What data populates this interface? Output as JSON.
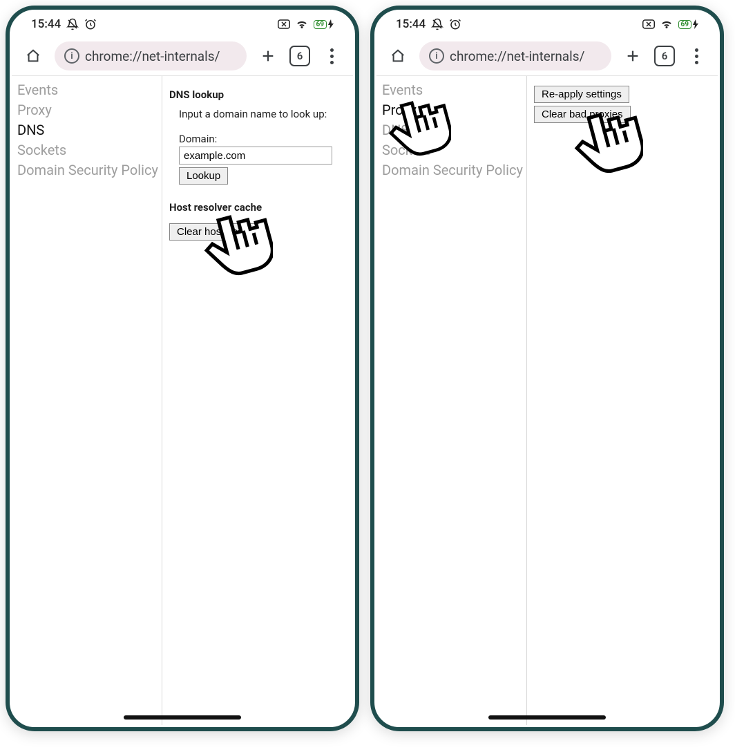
{
  "statusbar": {
    "time": "15:44",
    "battery": "69"
  },
  "chrome": {
    "url": "chrome://net-internals/",
    "tab_count": "6"
  },
  "sidebar": {
    "items": [
      {
        "label": "Events"
      },
      {
        "label": "Proxy"
      },
      {
        "label": "DNS"
      },
      {
        "label": "Sockets"
      },
      {
        "label": "Domain Security Policy"
      }
    ]
  },
  "left_panel": {
    "active_index": 2,
    "dns_heading": "DNS lookup",
    "dns_hint": "Input a domain name to look up:",
    "domain_label": "Domain:",
    "domain_value": "example.com",
    "lookup_label": "Lookup",
    "cache_heading": "Host resolver cache",
    "clear_cache_label": "Clear host cache"
  },
  "right_panel": {
    "active_index": 1,
    "reapply_label": "Re-apply settings",
    "clear_bad_label": "Clear bad proxies"
  }
}
